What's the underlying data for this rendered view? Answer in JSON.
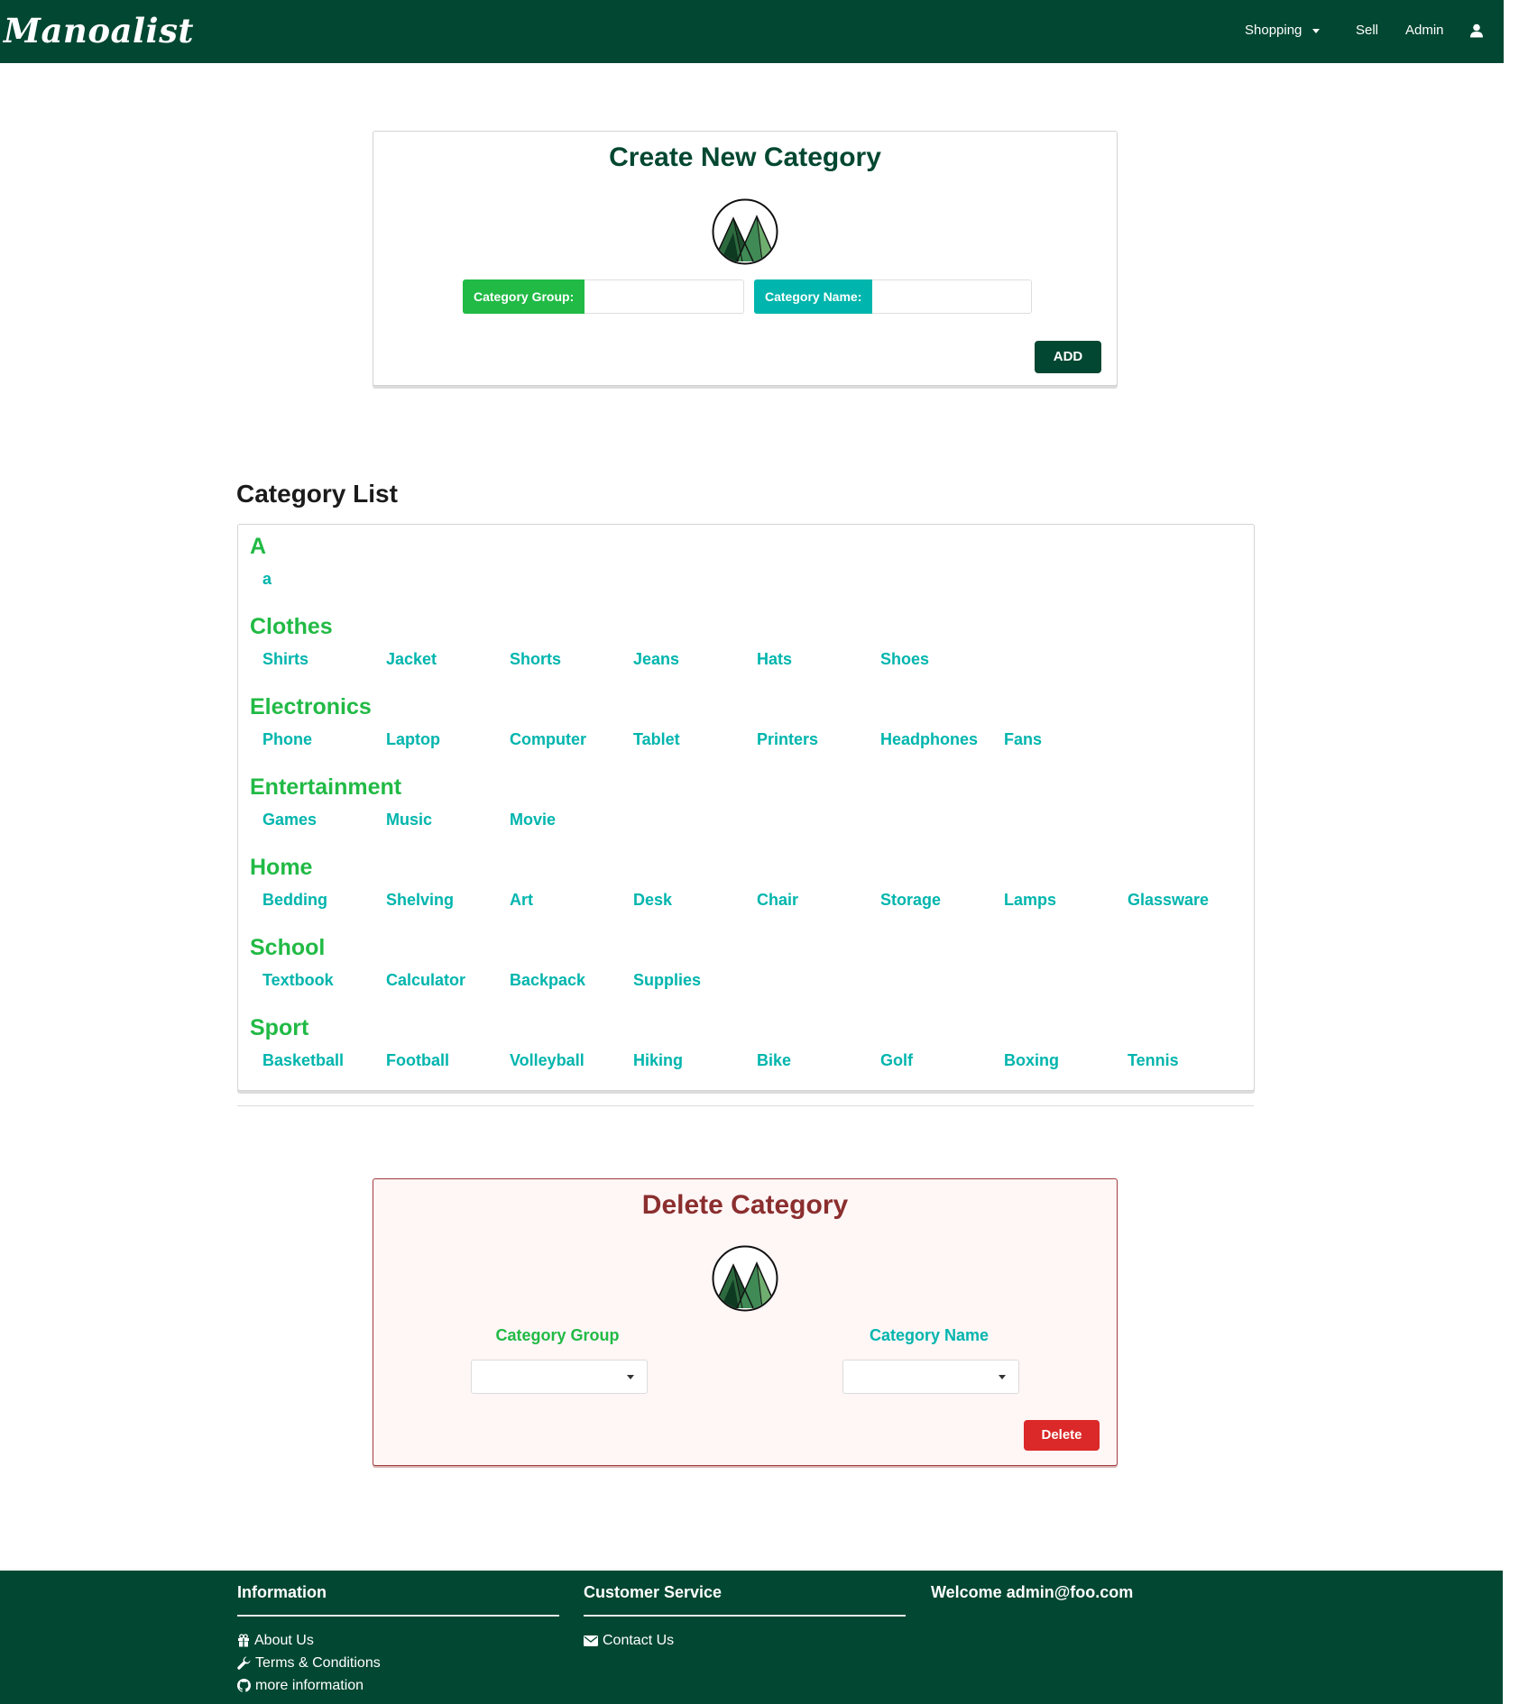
{
  "nav": {
    "brand": "Manoalist",
    "shopping": "Shopping",
    "sell": "Sell",
    "admin": "Admin"
  },
  "create": {
    "title": "Create New Category",
    "group_label": "Category Group:",
    "name_label": "Category Name:",
    "group_value": "",
    "name_value": "",
    "add_label": "ADD"
  },
  "list": {
    "heading": "Category List",
    "groups": [
      {
        "name": "A",
        "items": [
          "a"
        ]
      },
      {
        "name": "Clothes",
        "items": [
          "Shirts",
          "Jacket",
          "Shorts",
          "Jeans",
          "Hats",
          "Shoes"
        ]
      },
      {
        "name": "Electronics",
        "items": [
          "Phone",
          "Laptop",
          "Computer",
          "Tablet",
          "Printers",
          "Headphones",
          "Fans"
        ]
      },
      {
        "name": "Entertainment",
        "items": [
          "Games",
          "Music",
          "Movie"
        ]
      },
      {
        "name": "Home",
        "items": [
          "Bedding",
          "Shelving",
          "Art",
          "Desk",
          "Chair",
          "Storage",
          "Lamps",
          "Glassware"
        ]
      },
      {
        "name": "School",
        "items": [
          "Textbook",
          "Calculator",
          "Backpack",
          "Supplies"
        ]
      },
      {
        "name": "Sport",
        "items": [
          "Basketball",
          "Football",
          "Volleyball",
          "Hiking",
          "Bike",
          "Golf",
          "Boxing",
          "Tennis"
        ]
      }
    ]
  },
  "delete": {
    "title": "Delete Category",
    "group_label": "Category Group",
    "name_label": "Category Name",
    "group_selected": "",
    "name_selected": "",
    "delete_label": "Delete"
  },
  "footer": {
    "info_title": "Information",
    "about": "About Us",
    "terms": "Terms & Conditions",
    "more": "more information",
    "cs_title": "Customer Service",
    "contact": "Contact Us",
    "welcome": "Welcome admin@foo.com"
  },
  "colors": {
    "primary": "#024731",
    "green": "#21ba45",
    "teal": "#00b5ad",
    "red": "#db2828",
    "delete_title": "#8b2e2e"
  },
  "icons": [
    "caret-down-icon",
    "user-icon",
    "mountain-logo",
    "gift-icon",
    "wrench-icon",
    "github-icon",
    "envelope-icon"
  ]
}
